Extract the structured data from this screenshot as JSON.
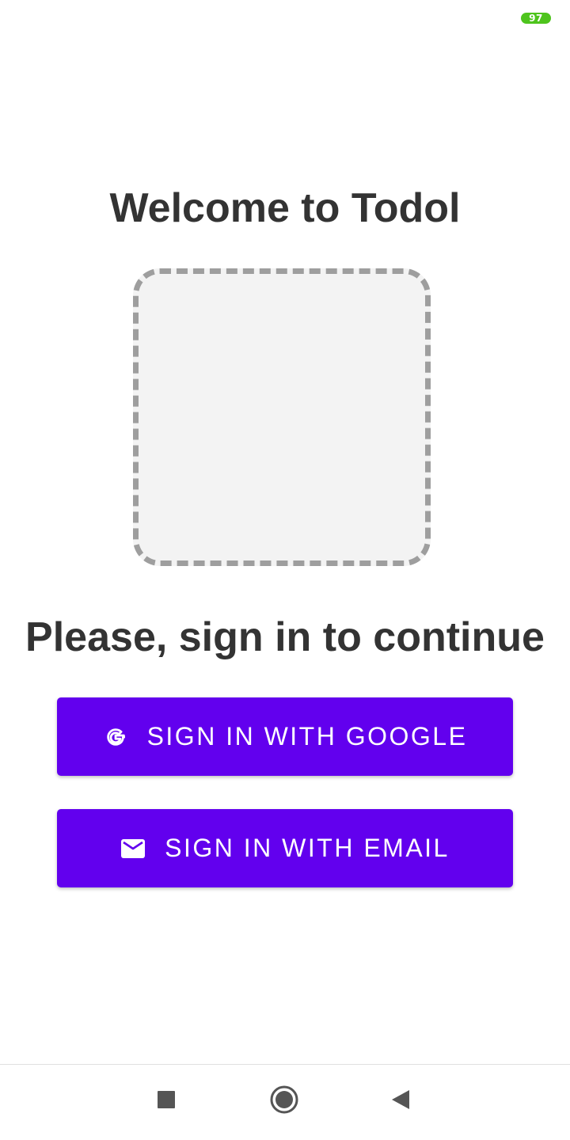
{
  "status_bar": {
    "battery_level": "97",
    "battery_color": "#4ec41d"
  },
  "welcome": {
    "title": "Welcome to Todol",
    "subtitle": "Please, sign in to continue"
  },
  "logo": {
    "icon": "image-placeholder"
  },
  "buttons": {
    "google": {
      "label": "SIGN IN WITH GOOGLE",
      "icon": "google-icon"
    },
    "email": {
      "label": "SIGN IN WITH EMAIL",
      "icon": "mail-icon"
    }
  },
  "navigation": {
    "recents_icon": "square-icon",
    "home_icon": "circle-icon",
    "back_icon": "triangle-back-icon"
  },
  "colors": {
    "accent": "#6200ee",
    "text": "#333333",
    "placeholder_border": "#9e9e9e",
    "placeholder_fill": "#f3f3f3"
  }
}
